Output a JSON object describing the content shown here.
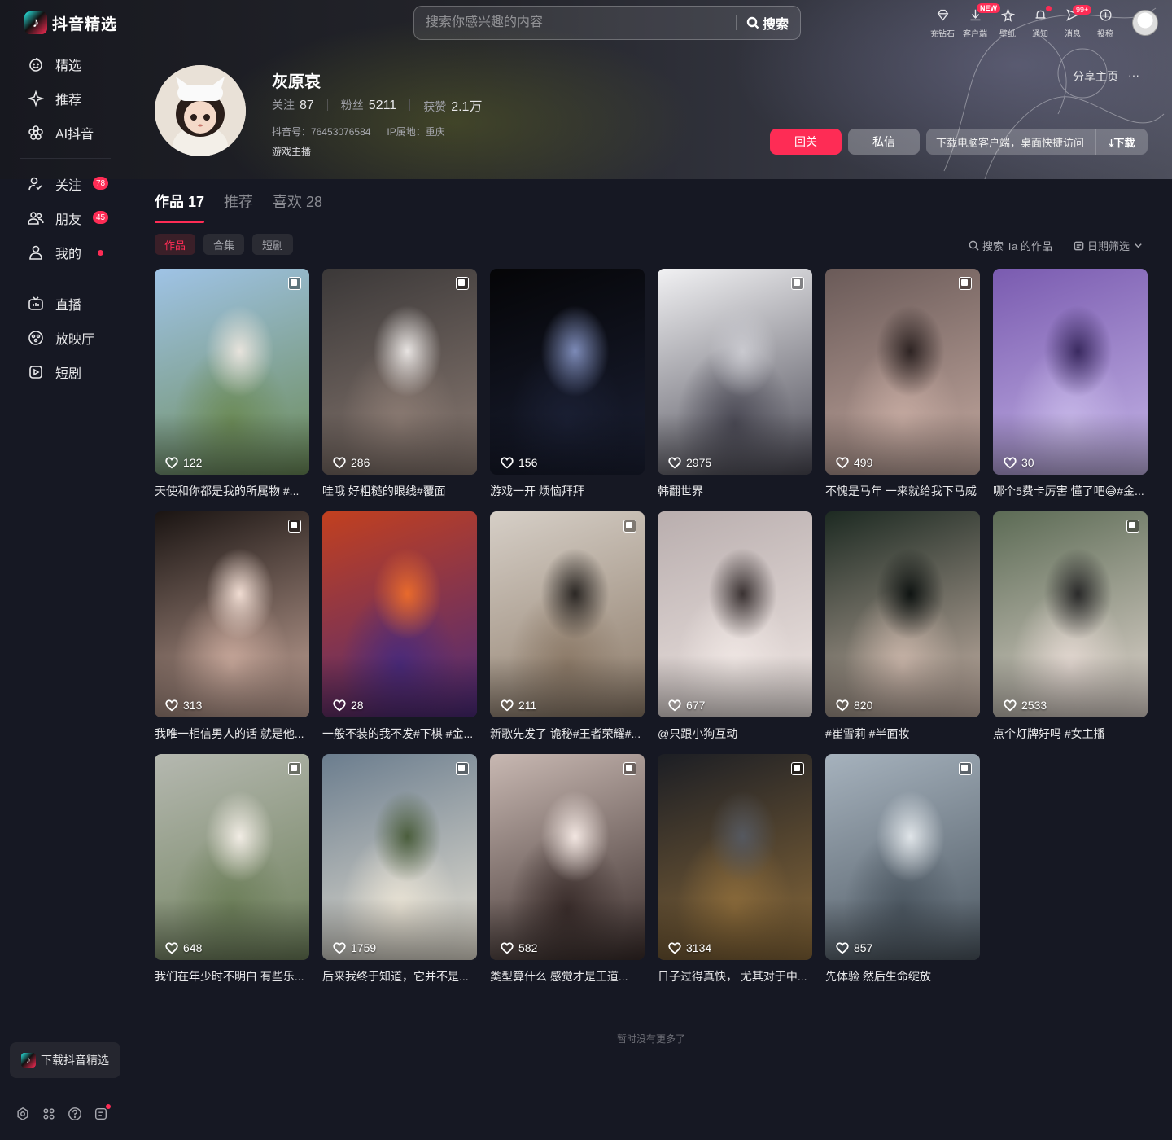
{
  "app": {
    "name": "抖音精选",
    "logo_glyph": "♪"
  },
  "sidebar": {
    "group1": [
      {
        "label": "精选",
        "icon": "face-icon"
      },
      {
        "label": "推荐",
        "icon": "sparkle-icon"
      },
      {
        "label": "AI抖音",
        "icon": "ai-flower-icon"
      }
    ],
    "group2": [
      {
        "label": "关注",
        "icon": "follow-icon",
        "badge": "78"
      },
      {
        "label": "朋友",
        "icon": "friends-icon",
        "badge": "45"
      },
      {
        "label": "我的",
        "icon": "user-icon",
        "dot": true
      }
    ],
    "group3": [
      {
        "label": "直播",
        "icon": "tv-icon"
      },
      {
        "label": "放映厅",
        "icon": "film-icon"
      },
      {
        "label": "短剧",
        "icon": "drama-icon"
      }
    ],
    "download_label": "下载抖音精选"
  },
  "search": {
    "placeholder": "搜索你感兴趣的内容",
    "button": "搜索"
  },
  "topbar": {
    "items": [
      {
        "label": "充钻石",
        "icon": "diamond-icon"
      },
      {
        "label": "客户端",
        "icon": "download-icon"
      },
      {
        "label": "壁纸",
        "icon": "wallpaper-icon"
      },
      {
        "label": "通知",
        "icon": "bell-icon"
      },
      {
        "label": "消息",
        "icon": "message-icon"
      },
      {
        "label": "投稿",
        "icon": "upload-icon"
      }
    ],
    "new_badge": "NEW",
    "msg_badge": "99+"
  },
  "profile": {
    "name": "灰原哀",
    "following_label": "关注",
    "following": "87",
    "followers_label": "粉丝",
    "followers": "5211",
    "likes_label": "获赞",
    "likes": "2.1万",
    "douyin_id": "抖音号：76453076584",
    "ip": "IP属地：重庆",
    "tagline": "游戏主播",
    "share_label": "分享主页",
    "more_label": "···",
    "follow_back": "回关",
    "message": "私信",
    "client_prompt": "下载电脑客户端，桌面快捷访问",
    "download": "⤓下载"
  },
  "tabs": [
    {
      "label": "作品 17",
      "active": true
    },
    {
      "label": "推荐",
      "active": false
    },
    {
      "label": "喜欢 28",
      "active": false
    }
  ],
  "subtabs": [
    {
      "label": "作品",
      "active": true
    },
    {
      "label": "合集",
      "active": false
    },
    {
      "label": "短剧",
      "active": false
    }
  ],
  "tools": {
    "search_works": "搜索 Ta 的作品",
    "date_filter": "日期筛选"
  },
  "videos": [
    {
      "likes": "122",
      "caption": "天使和你都是我的所属物 #...",
      "multi": true,
      "colors": [
        "#9fc3e6",
        "#6c8b58",
        "#e7e3dc"
      ]
    },
    {
      "likes": "286",
      "caption": "哇哦 好粗糙的眼线#覆面",
      "multi": true,
      "colors": [
        "#3b3838",
        "#8a7a72",
        "#e8e4e2"
      ]
    },
    {
      "likes": "156",
      "caption": "游戏一开 烦恼拜拜",
      "multi": false,
      "colors": [
        "#050507",
        "#1a1f33",
        "#7d8bb8"
      ]
    },
    {
      "likes": "2975",
      "caption": "韩翻世界",
      "multi": true,
      "colors": [
        "#f1f1f3",
        "#4b4a55",
        "#c9c9cf"
      ]
    },
    {
      "likes": "499",
      "caption": "不愧是马年 一来就给我下马威",
      "multi": true,
      "colors": [
        "#6a5a58",
        "#c4a9a0",
        "#2e2423"
      ]
    },
    {
      "likes": "30",
      "caption": "哪个5费卡厉害 懂了吧😅#金...",
      "multi": false,
      "colors": [
        "#7a5bb0",
        "#c4b4e6",
        "#3a2a60"
      ]
    },
    {
      "likes": "313",
      "caption": "我唯一相信男人的话 就是他...",
      "multi": true,
      "colors": [
        "#1a1412",
        "#c7a79a",
        "#f0dcd2"
      ]
    },
    {
      "likes": "28",
      "caption": "一般不装的我不发#下棋 #金...",
      "multi": false,
      "colors": [
        "#c2401f",
        "#4a2a7a",
        "#e86a2c"
      ]
    },
    {
      "likes": "211",
      "caption": "新歌先发了 诡秘#王者荣耀#...",
      "multi": true,
      "colors": [
        "#d6cfc7",
        "#8c7a68",
        "#2b2724"
      ]
    },
    {
      "likes": "677",
      "caption": "@只跟小狗互动",
      "multi": false,
      "colors": [
        "#b9aeae",
        "#efe6e3",
        "#3a3232"
      ]
    },
    {
      "likes": "820",
      "caption": "#崔雪莉 #半面妆",
      "multi": false,
      "colors": [
        "#1d2a22",
        "#c8b4a8",
        "#0f1412"
      ]
    },
    {
      "likes": "2533",
      "caption": "点个灯牌好吗 #女主播",
      "multi": true,
      "colors": [
        "#5c6b55",
        "#e2d7d0",
        "#2a2a2a"
      ]
    },
    {
      "likes": "648",
      "caption": "我们在年少时不明白 有些乐...",
      "multi": true,
      "colors": [
        "#b5b8b0",
        "#6d7f5a",
        "#f1ece4"
      ]
    },
    {
      "likes": "1759",
      "caption": "后来我终于知道，它并不是...",
      "multi": true,
      "colors": [
        "#6b7d8e",
        "#e8e2d4",
        "#4b5e3d"
      ]
    },
    {
      "likes": "582",
      "caption": "类型算什么 感觉才是王道...",
      "multi": true,
      "colors": [
        "#c8b8b2",
        "#3a2d2b",
        "#f2e6e1"
      ]
    },
    {
      "likes": "3134",
      "caption": "日子过得真快，  尤其对于中...",
      "multi": true,
      "colors": [
        "#1c1e24",
        "#8a6a3a",
        "#55585f"
      ]
    },
    {
      "likes": "857",
      "caption": "先体验 然后生命绽放",
      "multi": true,
      "colors": [
        "#a6b2bd",
        "#4c5761",
        "#dfe4e8"
      ]
    }
  ],
  "end_text": "暂时没有更多了"
}
